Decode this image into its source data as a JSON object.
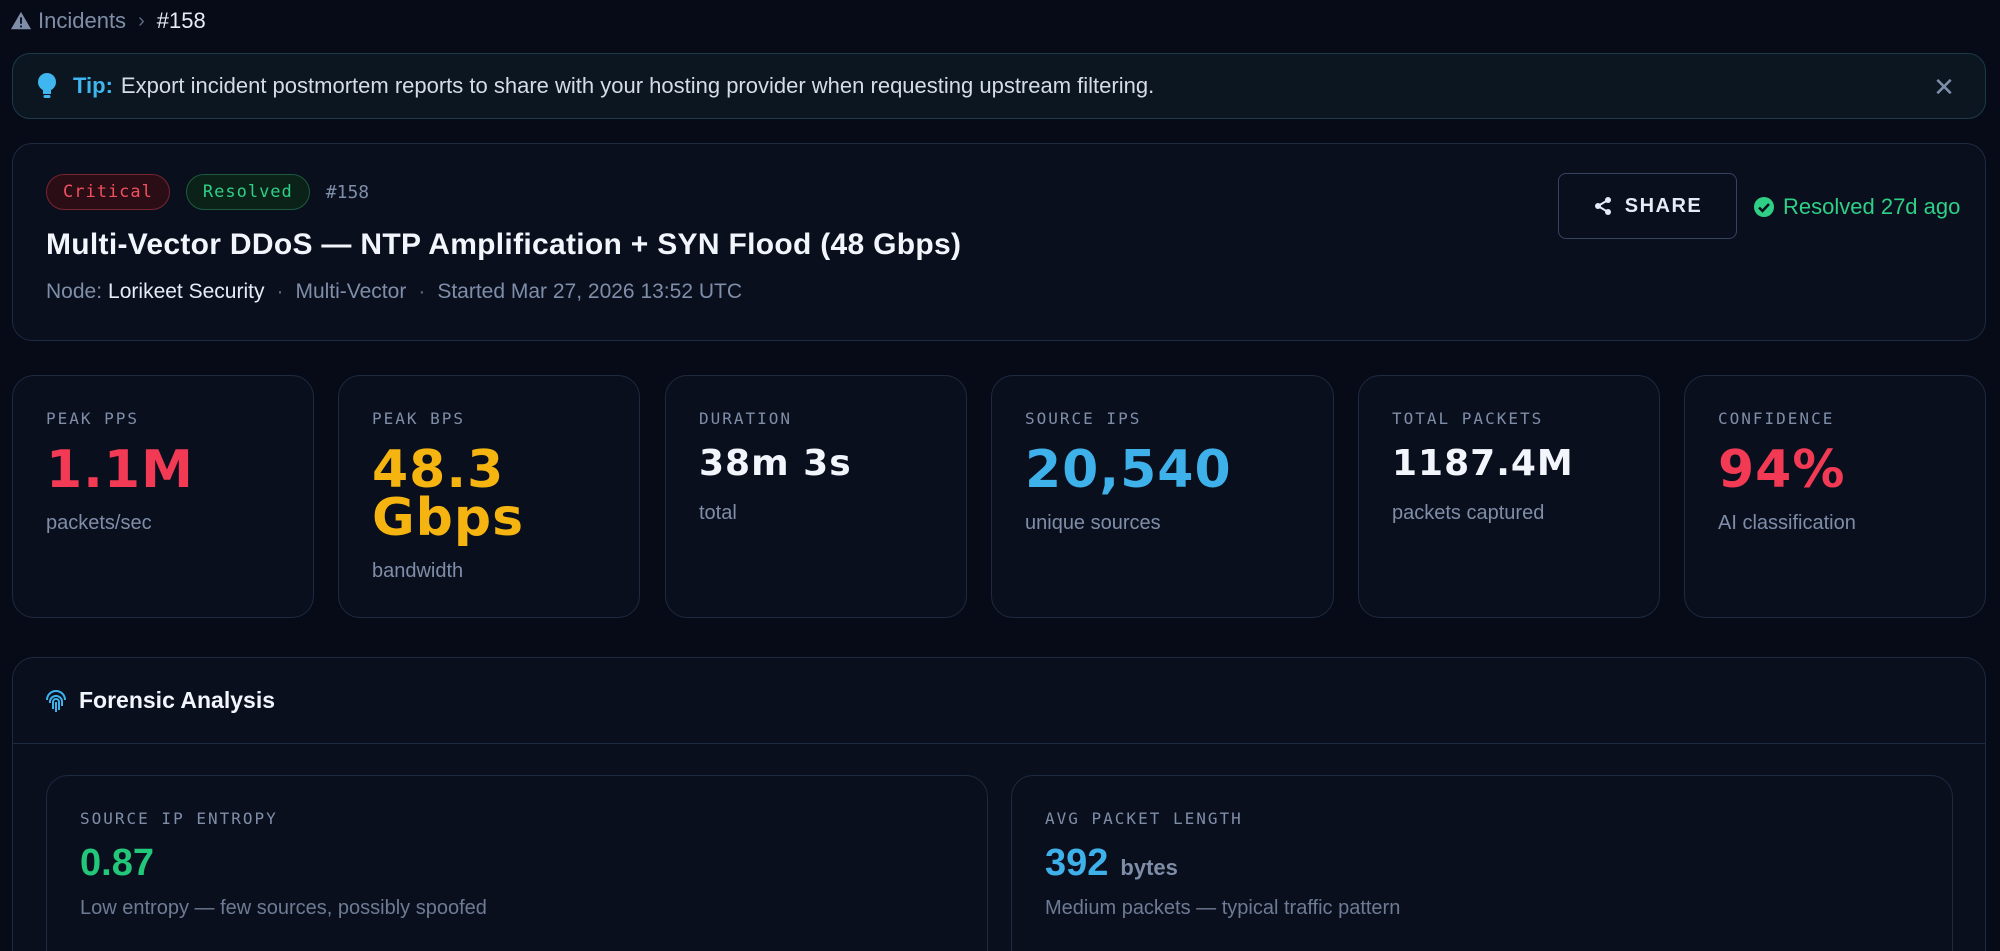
{
  "breadcrumb": {
    "parent": "Incidents",
    "current": "#158"
  },
  "tip": {
    "label": "Tip:",
    "text": "Export incident postmortem reports to share with your hosting provider when requesting upstream filtering."
  },
  "incident": {
    "severity": "Critical",
    "status": "Resolved",
    "id": "#158",
    "title": "Multi-Vector DDoS — NTP Amplification + SYN Flood (48 Gbps)",
    "node_label": "Node:",
    "node": "Lorikeet Security",
    "vector": "Multi-Vector",
    "started": "Started Mar 27, 2026 13:52 UTC",
    "share_label": "SHARE",
    "resolved_text": "Resolved 27d ago"
  },
  "stats": [
    {
      "label": "PEAK PPS",
      "value": "1.1M",
      "sub": "packets/sec",
      "color": "#f23a54"
    },
    {
      "label": "PEAK BPS",
      "value_line1": "48.3",
      "value_line2": "Gbps",
      "sub": "bandwidth",
      "color": "#f5b40f"
    },
    {
      "label": "DURATION",
      "value": "38m 3s",
      "sub": "total",
      "color": "#f2f5fb"
    },
    {
      "label": "SOURCE IPS",
      "value": "20,540",
      "sub": "unique sources",
      "color": "#3fb1ea"
    },
    {
      "label": "TOTAL PACKETS",
      "value": "1187.4M",
      "sub": "packets captured",
      "color": "#f2f5fb"
    },
    {
      "label": "CONFIDENCE",
      "value": "94%",
      "sub": "AI classification",
      "color": "#f23a54"
    }
  ],
  "forensic": {
    "title": "Forensic Analysis",
    "cards": [
      {
        "label": "SOURCE IP ENTROPY",
        "value": "0.87",
        "unit": "",
        "sub": "Low entropy — few sources, possibly spoofed",
        "color": "#22c77a"
      },
      {
        "label": "AVG PACKET LENGTH",
        "value": "392",
        "unit": "bytes",
        "sub": "Medium packets — typical traffic pattern",
        "color": "#3fb1ea"
      }
    ]
  },
  "icons": {
    "breadcrumb": "warning-triangle-icon",
    "tip": "lightbulb-icon",
    "close": "close-icon",
    "share": "share-icon",
    "resolved": "check-circle-icon",
    "forensic": "fingerprint-icon"
  }
}
